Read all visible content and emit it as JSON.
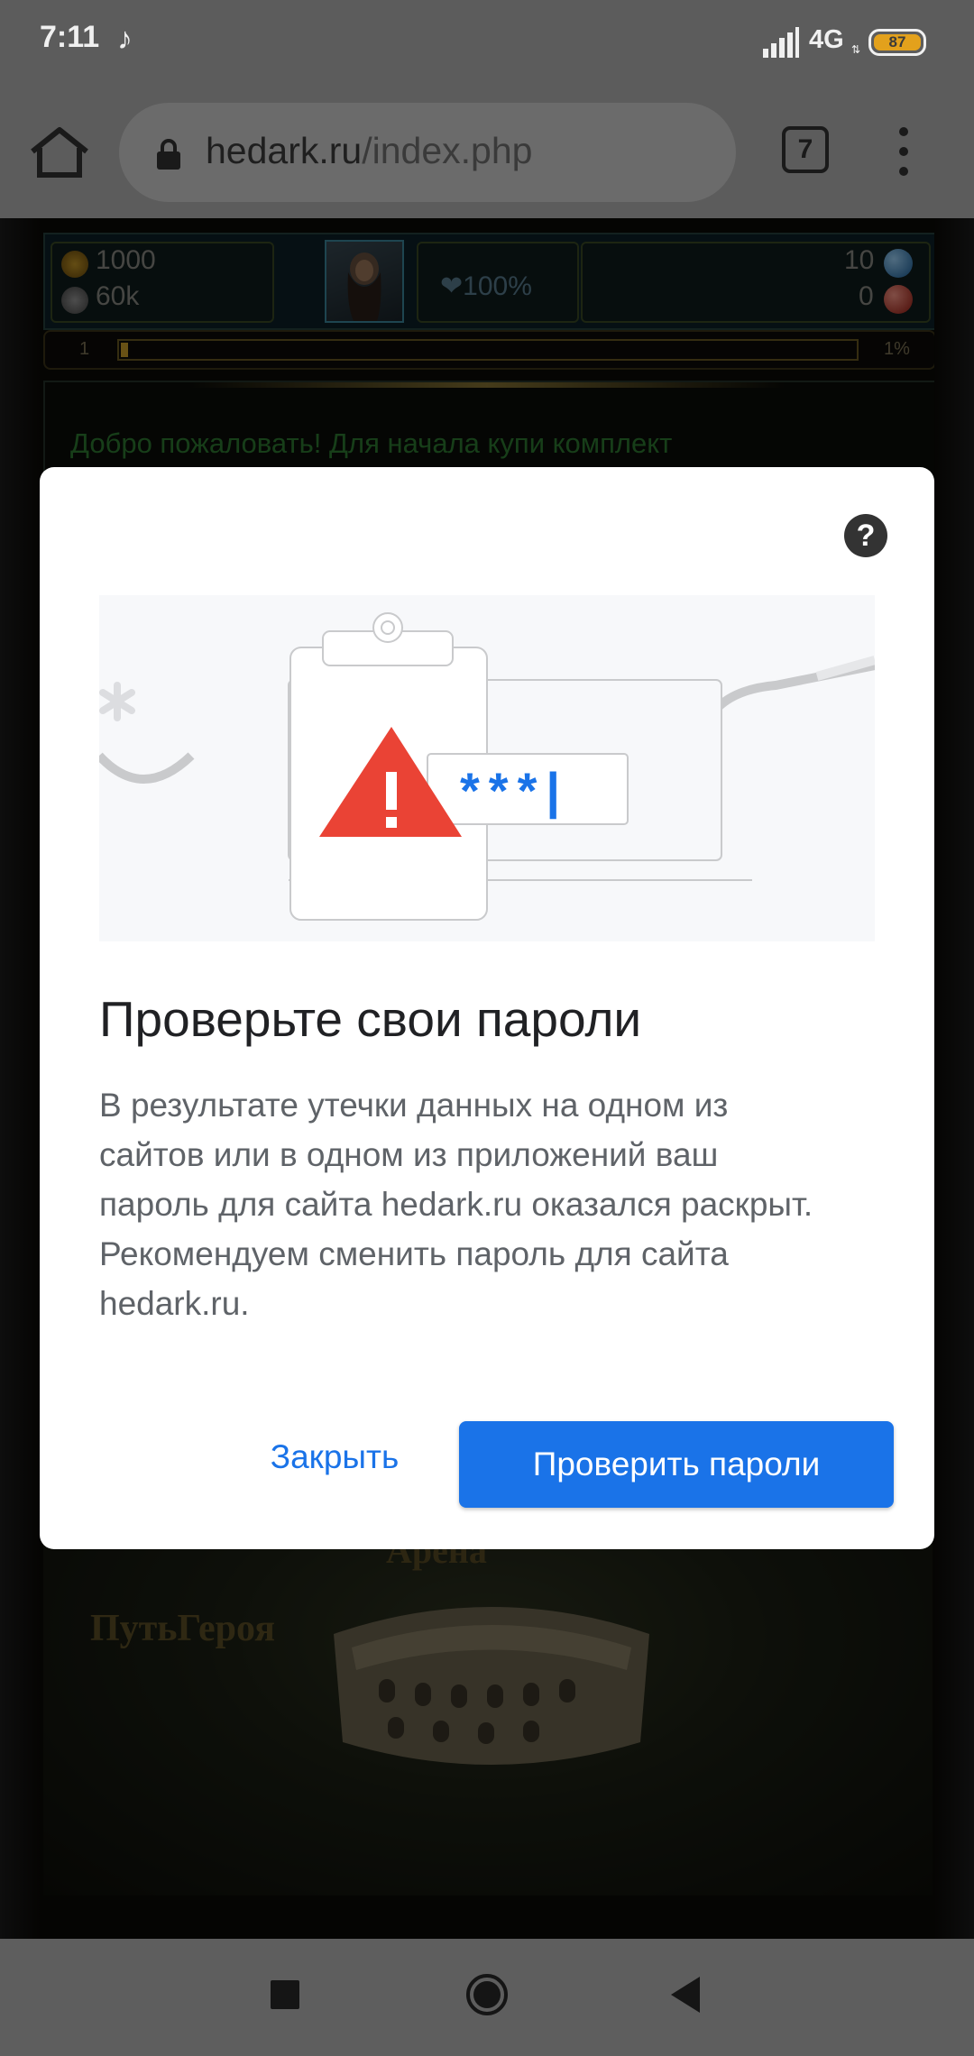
{
  "status": {
    "time": "7:11",
    "network": "4G",
    "battery": "87"
  },
  "browser": {
    "url_host": "hedark.ru",
    "url_path": "/index.php",
    "tab_count": "7"
  },
  "hud": {
    "gold": "1000",
    "silver": "60k",
    "health": "100%",
    "blue_gems": "10",
    "red_gems": "0"
  },
  "xp": {
    "level": "1",
    "percent_label": "1%",
    "progress": 0.01
  },
  "page": {
    "welcome": "Добро пожаловать! Для начала купи комплект",
    "arena_label": "Арена",
    "hero_path_label": "ПутьГероя"
  },
  "dialog": {
    "title": "Проверьте свои пароли",
    "body_lines": [
      "В результате утечки данных на одном из",
      "сайтов или в одном из приложений ваш",
      "пароль для сайта hedark.ru оказался раскрыт.",
      "Рекомендуем сменить пароль для сайта",
      "hedark.ru."
    ],
    "close_button": "Закрыть",
    "check_button": "Проверить пароли",
    "illustration_password": "***|"
  },
  "colors": {
    "accent": "#1a73e8",
    "warning": "#ea4335"
  },
  "icons": {
    "home": "home-icon",
    "lock": "lock-icon",
    "menu": "more-vert-icon",
    "help": "help-icon",
    "nav_recent": "square-icon",
    "nav_home": "circle-icon",
    "nav_back": "triangle-back-icon"
  }
}
